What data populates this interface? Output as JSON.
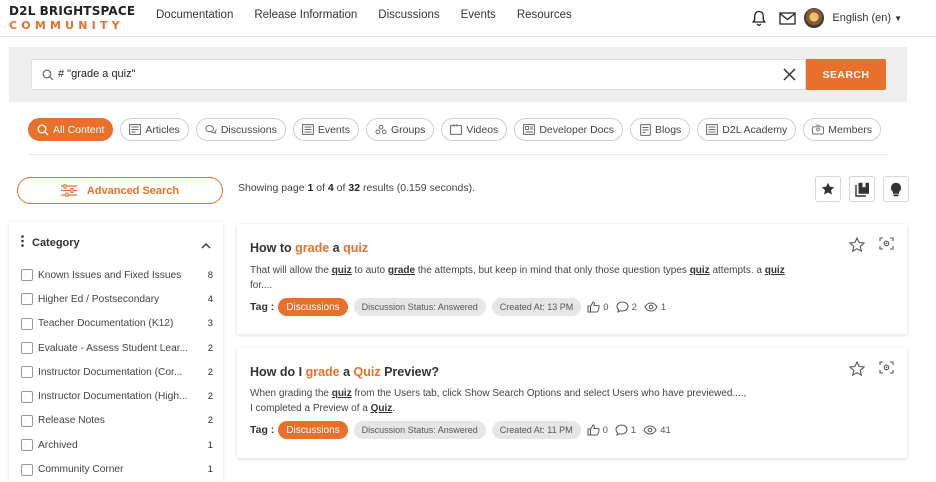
{
  "logo": {
    "line1_a": "D2L",
    "line1_b": "BRIGHTSPACE",
    "line2": "COMMUNITY"
  },
  "nav": [
    "Documentation",
    "Release Information",
    "Discussions",
    "Events",
    "Resources"
  ],
  "language": "English (en)",
  "search": {
    "query": "# \"grade a quiz\"",
    "button": "SEARCH"
  },
  "filters": [
    {
      "label": "All Content",
      "icon": "search-icon"
    },
    {
      "label": "Articles",
      "icon": "article-icon"
    },
    {
      "label": "Discussions",
      "icon": "discussion-icon"
    },
    {
      "label": "Events",
      "icon": "event-icon"
    },
    {
      "label": "Groups",
      "icon": "groups-icon"
    },
    {
      "label": "Videos",
      "icon": "video-icon"
    },
    {
      "label": "Developer Docs",
      "icon": "docs-icon"
    },
    {
      "label": "Blogs",
      "icon": "blog-icon"
    },
    {
      "label": "D2L Academy",
      "icon": "academy-icon"
    },
    {
      "label": "Members",
      "icon": "members-icon"
    }
  ],
  "advanced_search": "Advanced Search",
  "results": {
    "prefix": "Showing page ",
    "page": "1",
    "of": " of ",
    "pages": "4",
    "of2": " of ",
    "total": "32",
    "suffix": " results (0.159 seconds)."
  },
  "sidebar": {
    "heading": "Category",
    "items": [
      {
        "name": "Known Issues and Fixed Issues",
        "count": "8"
      },
      {
        "name": "Higher Ed / Postsecondary",
        "count": "4"
      },
      {
        "name": "Teacher Documentation (K12)",
        "count": "3"
      },
      {
        "name": "Evaluate - Assess Student Lear...",
        "count": "2"
      },
      {
        "name": "Instructor Documentation (Cor...",
        "count": "2"
      },
      {
        "name": "Instructor Documentation (High...",
        "count": "2"
      },
      {
        "name": "Release Notes",
        "count": "2"
      },
      {
        "name": "Archived",
        "count": "1"
      },
      {
        "name": "Community Corner",
        "count": "1"
      }
    ]
  },
  "cards": [
    {
      "title": {
        "t1": "How to ",
        "t2": "grade",
        "t3": " a ",
        "t4": "quiz",
        "t5": ""
      },
      "body": {
        "p1": "That will allow the ",
        "b1": "quiz",
        "p2": " to auto ",
        "b2": "grade",
        "p3": " the attempts, but keep in mind that only those question types ",
        "b3": "quiz",
        "p4": " attempts. a ",
        "b4": "quiz",
        "p5": " for...."
      },
      "tag_label": "Tag :",
      "tag": "Discussions",
      "status": "Discussion Status: Answered",
      "created": "Created At: 13 PM",
      "likes": "0",
      "comments": "2",
      "views": "1"
    },
    {
      "title": {
        "t1": "How do I ",
        "t2": "grade",
        "t3": " a ",
        "t4": "Quiz",
        "t5": " Preview?"
      },
      "body": {
        "p1": "When grading the ",
        "b1": "quiz",
        "p2": " from the Users tab, click Show Search Options and select Users who have previewed....,",
        "p3": "I completed a Preview of a ",
        "b2": "Quiz",
        "p4": "."
      },
      "tag_label": "Tag :",
      "tag": "Discussions",
      "status": "Discussion Status: Answered",
      "created": "Created At: 11 PM",
      "likes": "0",
      "comments": "1",
      "views": "41"
    }
  ],
  "colors": {
    "accent": "#e8702a",
    "band": "#eeeeee"
  }
}
